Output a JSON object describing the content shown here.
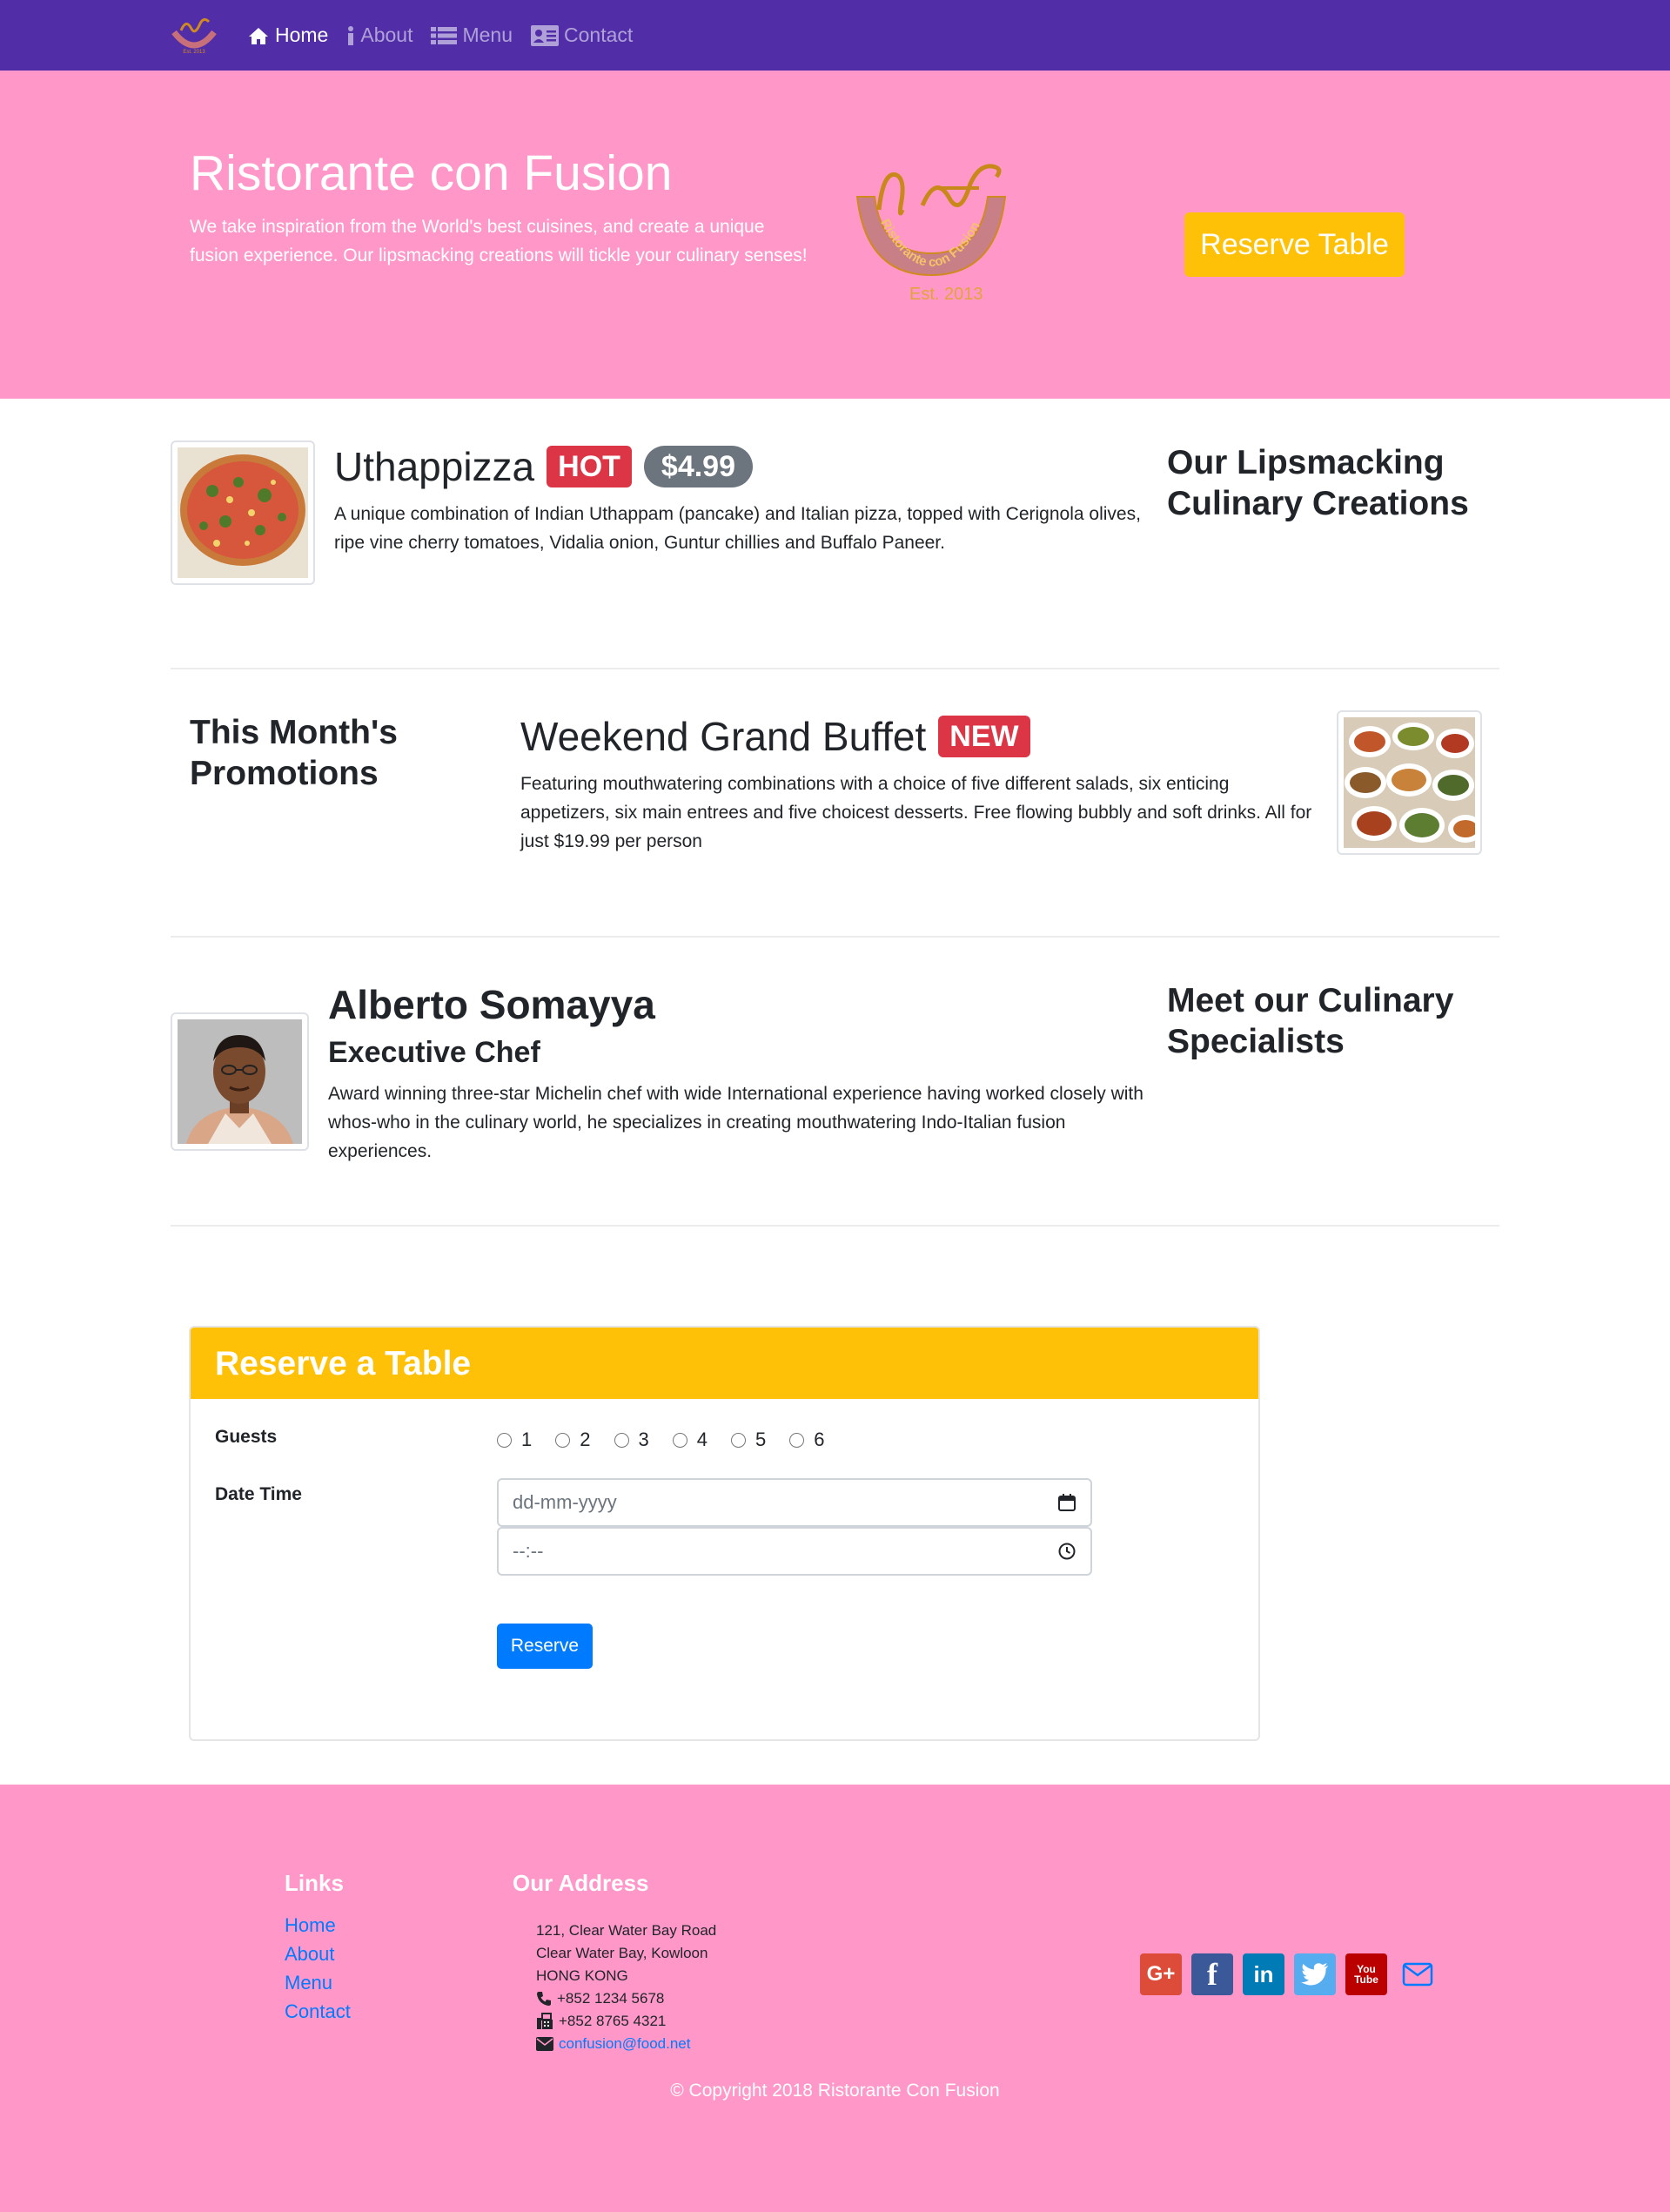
{
  "nav": {
    "brand_icon": "confusion-logo",
    "items": [
      {
        "label": "Home",
        "icon": "home-icon",
        "active": true
      },
      {
        "label": "About",
        "icon": "info-icon",
        "active": false
      },
      {
        "label": "Menu",
        "icon": "list-icon",
        "active": false
      },
      {
        "label": "Contact",
        "icon": "address-card-icon",
        "active": false
      }
    ]
  },
  "jumbotron": {
    "title": "Ristorante con Fusion",
    "text": "We take inspiration from the World's best cuisines, and create a unique fusion experience. Our lipsmacking creations will tickle your culinary senses!",
    "logo_text": "Ristorante con Fusion",
    "logo_est": "Est. 2013",
    "reserve_label": "Reserve Table"
  },
  "dish": {
    "name": "Uthappizza",
    "badge": "HOT",
    "price": "$4.99",
    "description": "A unique combination of Indian Uthappam (pancake) and Italian pizza, topped with Cerignola olives, ripe vine cherry tomatoes, Vidalia onion, Guntur chillies and Buffalo Paneer.",
    "side_heading": "Our Lipsmacking Culinary Creations"
  },
  "promotion": {
    "side_heading": "This Month's Promotions",
    "name": "Weekend Grand Buffet",
    "badge": "NEW",
    "description": "Featuring mouthwatering combinations with a choice of five different salads, six enticing appetizers, six main entrees and five choicest desserts. Free flowing bubbly and soft drinks. All for just $19.99 per person"
  },
  "leader": {
    "name": "Alberto Somayya",
    "designation": "Executive Chef",
    "description": "Award winning three-star Michelin chef with wide International experience having worked closely with whos-who in the culinary world, he specializes in creating mouthwatering Indo-Italian fusion experiences.",
    "side_heading": "Meet our Culinary Specialists"
  },
  "reserve": {
    "title": "Reserve a Table",
    "guests_label": "Guests",
    "guest_options": [
      "1",
      "2",
      "3",
      "4",
      "5",
      "6"
    ],
    "datetime_label": "Date Time",
    "date_placeholder": "dd-mm-yyyy",
    "time_placeholder": "--:--",
    "submit_label": "Reserve"
  },
  "footer": {
    "links_heading": "Links",
    "links": [
      "Home",
      "About",
      "Menu",
      "Contact"
    ],
    "address_heading": "Our Address",
    "address_lines": [
      "121, Clear Water Bay Road",
      "Clear Water Bay, Kowloon",
      "HONG KONG"
    ],
    "phone": "+852 1234 5678",
    "fax": "+852 8765 4321",
    "email": "confusion@food.net",
    "social": [
      {
        "icon": "google-plus-icon",
        "label": "G+",
        "color": "#DD4B39"
      },
      {
        "icon": "facebook-icon",
        "label": "f",
        "color": "#3B5998"
      },
      {
        "icon": "linkedin-icon",
        "label": "in",
        "color": "#007BB6"
      },
      {
        "icon": "twitter-icon",
        "label": "",
        "color": "#55ACEE"
      },
      {
        "icon": "youtube-icon",
        "label": "You Tube",
        "color": "#BB0000"
      },
      {
        "icon": "envelope-icon",
        "label": "",
        "color": "#007BFF"
      }
    ],
    "copyright": "© Copyright 2018 Ristorante Con Fusion"
  }
}
